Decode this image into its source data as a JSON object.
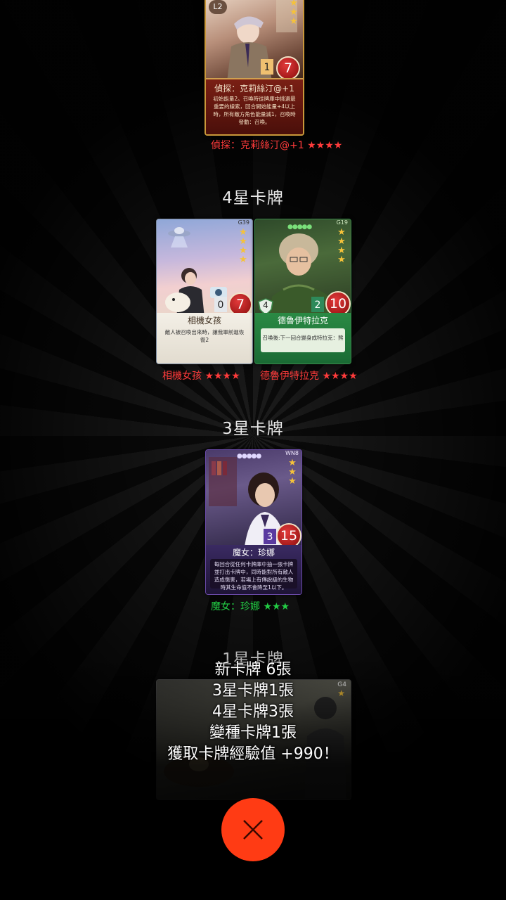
{
  "colors": {
    "accent_close": "#ff3b14",
    "rarity_4_label": "#ff3b3b",
    "rarity_3_label": "#22cc44",
    "star_gold": "#f5c23a"
  },
  "top_card": {
    "name": "偵探：克莉絲汀@+1",
    "level_badge": "L2",
    "attack": "1",
    "cost": "7",
    "description": "初始能量2。召喚時從牌庫中挑選最重要的線索，回合開始能量+4以上時，所有敵方角色能量減1，召喚時發動：召喚。",
    "label_name": "偵探：克莉絲汀@+1",
    "label_stars": "★★★★"
  },
  "sections": [
    {
      "title": "4星卡牌"
    },
    {
      "title": "3星卡牌"
    },
    {
      "title": "1星卡牌"
    }
  ],
  "four_star_cards": [
    {
      "name": "相機女孩",
      "code": "G39",
      "attack": "0",
      "cost": "7",
      "description": "敵人被召喚出來時，讓我軍前進恢復2",
      "label_name": "相機女孩",
      "label_stars": "★★★★"
    },
    {
      "name": "德魯伊特拉克",
      "code": "G19",
      "shield": "4",
      "attack": "2",
      "cost": "10",
      "description": "召喚後:下一回合變身成特拉克：熊",
      "label_name": "德魯伊特拉克",
      "label_stars": "★★★★"
    }
  ],
  "three_star_cards": [
    {
      "name": "魔女：珍娜",
      "code": "WN8",
      "attack": "3",
      "cost": "15",
      "description": "每回合從任何卡牌庫中抽一張卡牌並打出卡牌中，同時能對所有敵人造成傷害，若場上有傳說級的生物時其生命值不會降至1以下。",
      "label_name": "魔女：珍娜",
      "label_stars": "★★★"
    }
  ],
  "one_star_card": {
    "code": "G4"
  },
  "summary": {
    "line1": "新卡牌  6張",
    "line2": "3星卡牌1張",
    "line3": "4星卡牌3張",
    "line4": "變種卡牌1張",
    "line5": "獲取卡牌經驗值  +990！"
  },
  "icons": {
    "close": "close-icon",
    "star": "star-icon",
    "sword": "sword-icon",
    "shield": "shield-icon",
    "ufo": "ufo-icon"
  }
}
